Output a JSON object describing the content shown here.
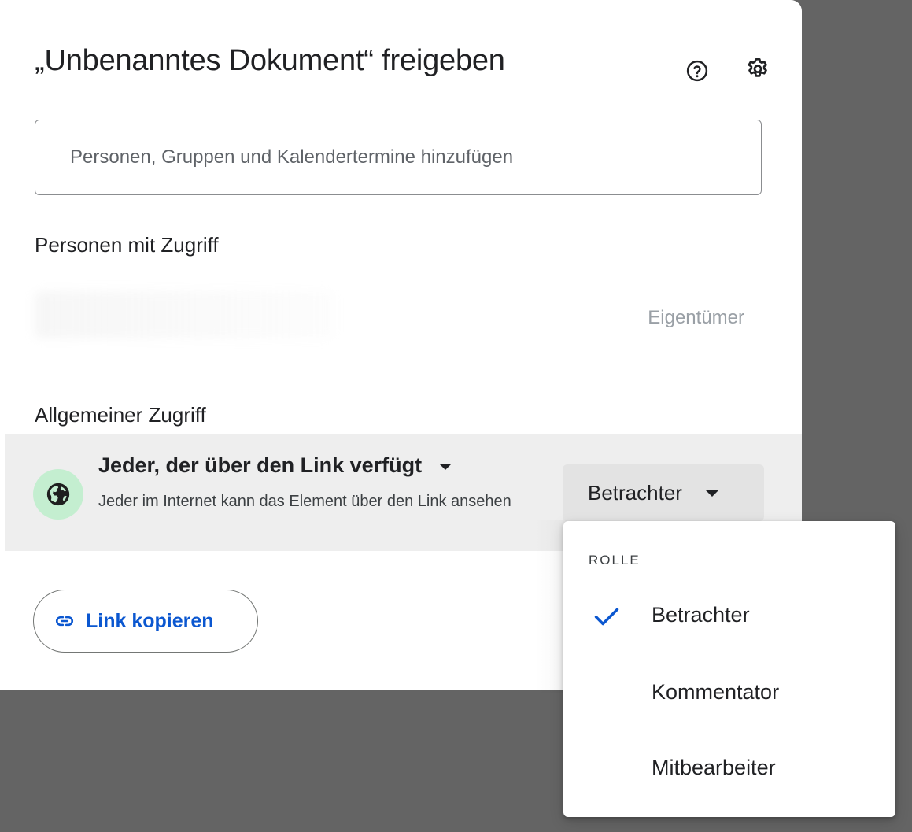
{
  "dialog": {
    "title": "„Unbenanntes Dokument“ freigeben",
    "add_placeholder": "Personen, Gruppen und Kalendertermine hinzufügen",
    "people_heading": "Personen mit Zugriff",
    "owner_role": "Eigentümer",
    "general_heading": "Allgemeiner Zugriff",
    "access_option": "Jeder, der über den Link verfügt",
    "access_description": "Jeder im Internet kann das Element über den Link ansehen",
    "role_value": "Betrachter",
    "copy_link_label": "Link kopieren"
  },
  "icons": {
    "help": "help-icon",
    "settings": "gear-icon",
    "globe": "globe-icon",
    "link": "link-icon",
    "check": "check-icon"
  },
  "role_menu": {
    "header": "ROLLE",
    "items": [
      {
        "label": "Betrachter",
        "selected": true
      },
      {
        "label": "Kommentator",
        "selected": false
      },
      {
        "label": "Mitbearbeiter",
        "selected": false
      }
    ]
  },
  "colors": {
    "background_overlay": "#646464",
    "accent_blue": "#0b57d0",
    "globe_circle": "#c4eed0",
    "general_row": "#eeeeee"
  }
}
